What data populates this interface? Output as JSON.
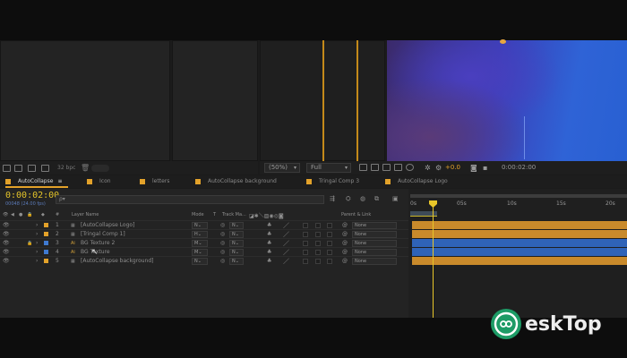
{
  "project_toolbar": {
    "bpc": "32 bpc"
  },
  "viewer_bar": {
    "magnification": "(50%)",
    "resolution": "Full",
    "exposure": "+0.0",
    "timecode": "0:00:02:00"
  },
  "tabs": [
    {
      "label": "AutoCollapse",
      "active": true
    },
    {
      "label": "Icon"
    },
    {
      "label": "letters"
    },
    {
      "label": "AutoCollapse background"
    },
    {
      "label": "Tringal Comp 3"
    },
    {
      "label": "AutoCollapse Logo"
    }
  ],
  "timeline": {
    "timecode": "0:00:02:00",
    "fps_label": "00048 (24.00 fps)",
    "search_placeholder": "ρ▾"
  },
  "columns": {
    "number": "#",
    "layer_name": "Layer Name",
    "mode": "Mode",
    "t": "T",
    "track_matte": "Track Ma...",
    "parent_link": "Parent & Link"
  },
  "layers": [
    {
      "num": "1",
      "name": "[AutoCollapse Logo]",
      "mode": "N⌄",
      "matte": "N⌄",
      "parent": "None",
      "label_color": "#e3a22a",
      "bar_color": "#c98a2b"
    },
    {
      "num": "2",
      "name": "[Tringal Comp 1]",
      "mode": "H⌄",
      "matte": "N⌄",
      "parent": "None",
      "label_color": "#e3a22a",
      "bar_color": "#c98a2b"
    },
    {
      "num": "3",
      "name": "BG Texture 2",
      "mode": "M⌄",
      "matte": "N⌄",
      "parent": "None",
      "label_color": "#3f7ad1",
      "bar_color": "#2f63b8"
    },
    {
      "num": "4",
      "name": "BG Texture",
      "mode": "M⌄",
      "matte": "N⌄",
      "parent": "None",
      "label_color": "#3f7ad1",
      "bar_color": "#2f63b8"
    },
    {
      "num": "5",
      "name": "[AutoCollapse background]",
      "mode": "N⌄",
      "matte": "N⌄",
      "parent": "None",
      "label_color": "#e3a22a",
      "bar_color": "#c98a2b"
    }
  ],
  "ruler_ticks": [
    "0s",
    "05s",
    "10s",
    "15s",
    "20s"
  ],
  "watermark": {
    "text": "eskTop"
  },
  "colors": {
    "accent_yellow": "#e3a22a",
    "timecode_yellow": "#e3c32a",
    "playhead": "#e8c629"
  }
}
